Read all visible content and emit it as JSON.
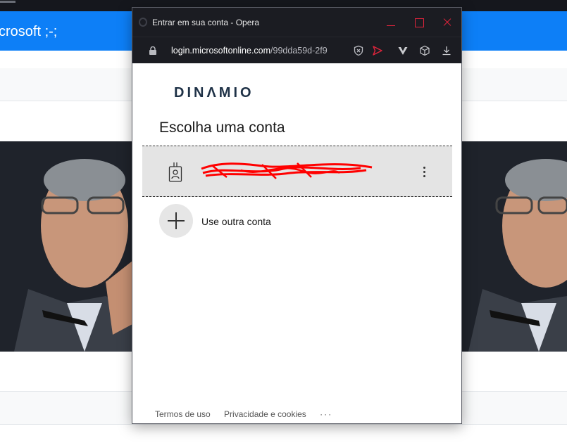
{
  "background": {
    "header_title": "crosoft ;-;"
  },
  "popup": {
    "window_title": "Entrar em sua conta - Opera",
    "url_domain": "login.microsoftonline.com",
    "url_path": "/99dda59d-2f9",
    "icons": {
      "lock": "lock-icon",
      "shield": "shield-x-icon",
      "send": "send-icon",
      "vpn": "vpn-icon",
      "cube": "cube-icon",
      "download": "download-icon"
    },
    "brand": "DINΛMIO",
    "heading": "Escolha uma conta",
    "account": {
      "email": "",
      "redacted": true
    },
    "use_other_label": "Use outra conta",
    "footer": {
      "terms": "Termos de uso",
      "privacy": "Privacidade e cookies",
      "more": "···"
    }
  },
  "colors": {
    "header_blue": "#0d7ff7",
    "titlebar_dark": "#1b1c22",
    "window_control_red": "#e0243c",
    "tile_gray": "#e4e4e4",
    "brand_navy": "#1f3247",
    "redaction_red": "#ff0000"
  }
}
